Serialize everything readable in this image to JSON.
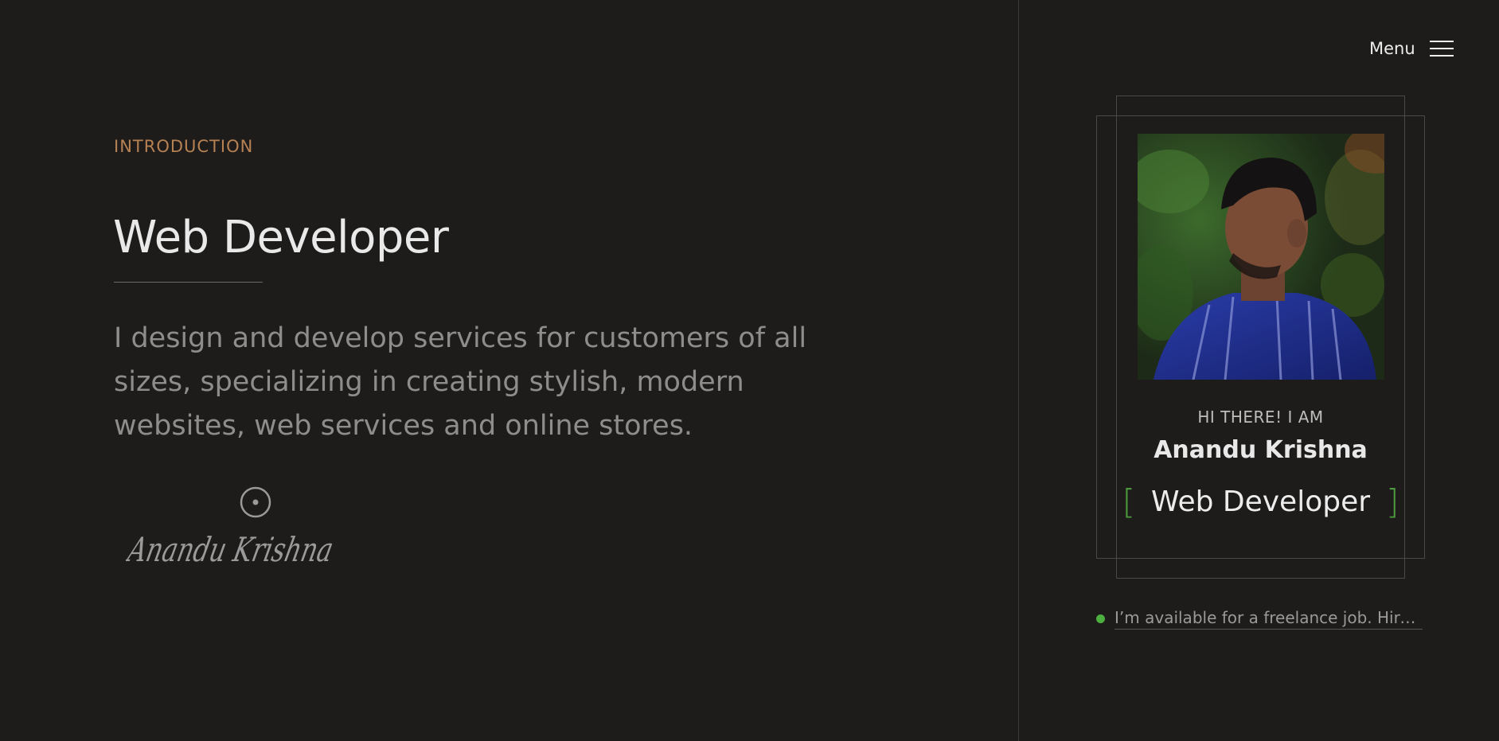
{
  "intro": {
    "label": "INTRODUCTION",
    "title": "Web Developer",
    "description": "I design and develop services for customers of all sizes, specializing in creating stylish, modern websites, web services and online stores.",
    "signature": "Anandu Krishna"
  },
  "menu": {
    "label": "Menu",
    "icon": "hamburger-icon"
  },
  "profile": {
    "greeting": "HI THERE! I AM",
    "name": "Anandu Krishna",
    "bracket_open": "[",
    "role": "Web Developer",
    "bracket_close": "]"
  },
  "availability": {
    "text": "I’m available for a freelance job. Hire me",
    "status_color": "#4caf3f"
  },
  "colors": {
    "background": "#1d1c1b",
    "accent": "#b68153",
    "bracket": "#4e9a3f"
  }
}
